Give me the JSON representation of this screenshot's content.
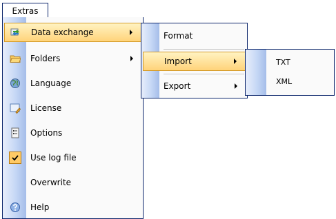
{
  "menubar": {
    "extras_label": "Extras"
  },
  "extras_menu": {
    "items": [
      {
        "label": "Data exchange",
        "icon": "data-exchange-icon",
        "has_submenu": true,
        "highlighted": true
      },
      {
        "label": "Folders",
        "icon": "folder-icon",
        "has_submenu": true
      },
      {
        "label": "Language",
        "icon": "globe-icon",
        "has_submenu": false
      },
      {
        "label": "License",
        "icon": "license-icon",
        "has_submenu": false
      },
      {
        "label": "Options",
        "icon": "options-icon",
        "has_submenu": false
      },
      {
        "label": "Use log file",
        "icon": "checkmark-icon",
        "has_submenu": false,
        "checked": true
      },
      {
        "label": "Overwrite",
        "icon": "",
        "has_submenu": false
      },
      {
        "label": "Help",
        "icon": "help-icon",
        "has_submenu": false
      }
    ]
  },
  "data_exchange_menu": {
    "items": [
      {
        "label": "Format",
        "has_submenu": false
      },
      {
        "label": "Import",
        "has_submenu": true,
        "highlighted": true
      },
      {
        "label": "Export",
        "has_submenu": true
      }
    ]
  },
  "import_menu": {
    "items": [
      {
        "label": "TXT"
      },
      {
        "label": "XML"
      }
    ]
  },
  "colors": {
    "highlight": "#ffd37a",
    "border": "#0a246a",
    "strip": "#c5d7f5"
  }
}
